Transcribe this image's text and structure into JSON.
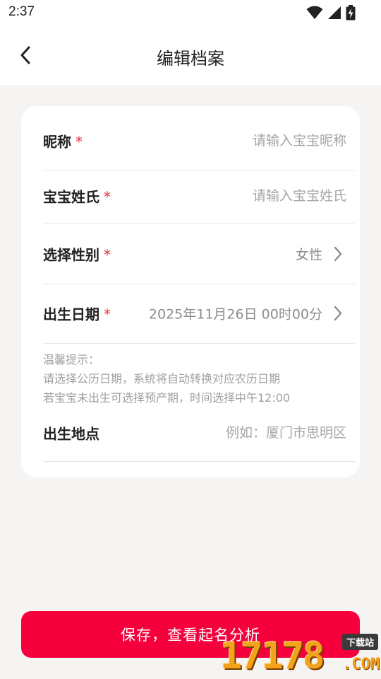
{
  "status_bar": {
    "time": "2:37",
    "icons": [
      "wifi-icon",
      "signal-icon",
      "battery-charging-icon"
    ]
  },
  "header": {
    "title": "编辑档案",
    "back_icon": "back-arrow-icon"
  },
  "form": {
    "nickname": {
      "label": "昵称",
      "required_mark": "*",
      "placeholder": "请输入宝宝昵称",
      "value": ""
    },
    "surname": {
      "label": "宝宝姓氏",
      "required_mark": "*",
      "placeholder": "请输入宝宝姓氏",
      "value": ""
    },
    "gender": {
      "label": "选择性别",
      "required_mark": "*",
      "value": "女性"
    },
    "birth_date": {
      "label": "出生日期",
      "required_mark": "*",
      "value": "2025年11月26日 00时00分"
    },
    "tips": {
      "title": "温馨提示：",
      "line1": "请选择公历日期，系统将自动转换对应农历日期",
      "line2": "若宝宝未出生可选择预产期，时间选择中午12:00"
    },
    "birthplace": {
      "label": "出生地点",
      "placeholder": "例如：厦门市思明区",
      "value": ""
    }
  },
  "save_button": {
    "label": "保存，查看起名分析"
  },
  "watermark": {
    "digits": "17178",
    "suffix": ".COM",
    "badge": "下载站"
  },
  "colors": {
    "accent": "#f5003c",
    "required": "#e8323c",
    "background": "#f6f4f3",
    "card": "#ffffff",
    "placeholder": "#a6a6a6"
  }
}
